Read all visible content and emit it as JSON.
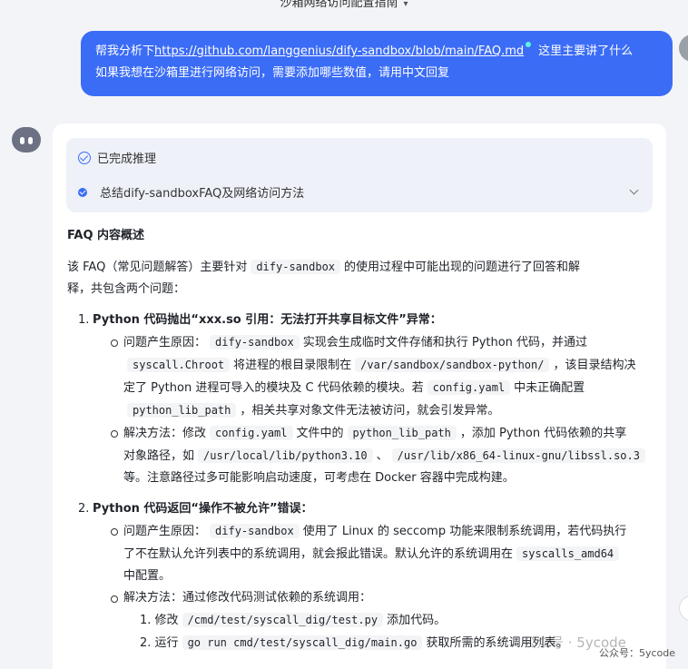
{
  "header": {
    "title": "沙箱网络访问配置指南"
  },
  "user_message": {
    "prefix": "帮我分析下",
    "link": "https://github.com/langgenius/dify-sandbox/blob/main/FAQ.md",
    "line1_suffix": "这里主要讲了什么",
    "line2": "如果我想在沙箱里进行网络访问，需要添加哪些数值，请用中文回复"
  },
  "reasoning": {
    "status": "已完成推理",
    "step": "总结dify-sandboxFAQ及网络访问方法"
  },
  "answer": {
    "heading": "FAQ 内容概述",
    "intro_a": "该 FAQ（常见问题解答）主要针对",
    "intro_code": "dify-sandbox",
    "intro_b": "的使用过程中可能出现的问题进行了回答和解",
    "intro_c": "释，共包含两个问题：",
    "q1": {
      "num": "1.",
      "title": "Python 代码抛出“xxx.so 引用：无法打开共享目标文件”异常：",
      "cause_label": "问题产生原因：",
      "cause_code1": "dify-sandbox",
      "cause_t1": "实现会生成临时文件存储和执行 Python 代码，并通过",
      "cause_code2": "syscall.Chroot",
      "cause_t2": "将进程的根目录限制在",
      "cause_code3": "/var/sandbox/sandbox-python/",
      "cause_t3": "，该目录结构决",
      "cause_t4": "定了 Python 进程可导入的模块及 C 代码依赖的模块。若",
      "cause_code4": "config.yaml",
      "cause_t5": "中未正确配置",
      "cause_code5": "python_lib_path",
      "cause_t6": "，相关共享对象文件无法被访问，就会引发异常。",
      "fix_label": "解决方法：修改",
      "fix_code1": "config.yaml",
      "fix_t1": "文件中的",
      "fix_code2": "python_lib_path",
      "fix_t2": "，添加 Python 代码依赖的共享",
      "fix_t3": "对象路径，如",
      "fix_code3": "/usr/local/lib/python3.10",
      "fix_t4": "、",
      "fix_code4": "/usr/lib/x86_64-linux-gnu/libssl.so.3",
      "fix_t5": "等。注意路径过多可能影响启动速度，可考虑在 Docker 容器中完成构建。"
    },
    "q2": {
      "num": "2.",
      "title": "Python 代码返回“操作不被允许”错误：",
      "cause_label": "问题产生原因：",
      "cause_code1": "dify-sandbox",
      "cause_t1": "使用了 Linux 的 seccomp 功能来限制系统调用，若代码执行",
      "cause_t2": "了不在默认允许列表中的系统调用，就会报此错误。默认允许的系统调用在",
      "cause_code2": "syscalls_amd64",
      "cause_t3": "中配置。",
      "fix_label": "解决方法：通过修改代码测试依赖的系统调用：",
      "steps": [
        {
          "num": "1.",
          "text_a": "修改",
          "code": "/cmd/test/syscall_dig/test.py",
          "text_b": "添加代码。"
        },
        {
          "num": "2.",
          "text_a": "运行",
          "code": "go run cmd/test/syscall_dig/main.go",
          "text_b": "获取所需的系统调用列表。"
        }
      ]
    }
  },
  "watermark": {
    "big": "公众号 · 5ycode",
    "small": "公众号：5ycode"
  }
}
